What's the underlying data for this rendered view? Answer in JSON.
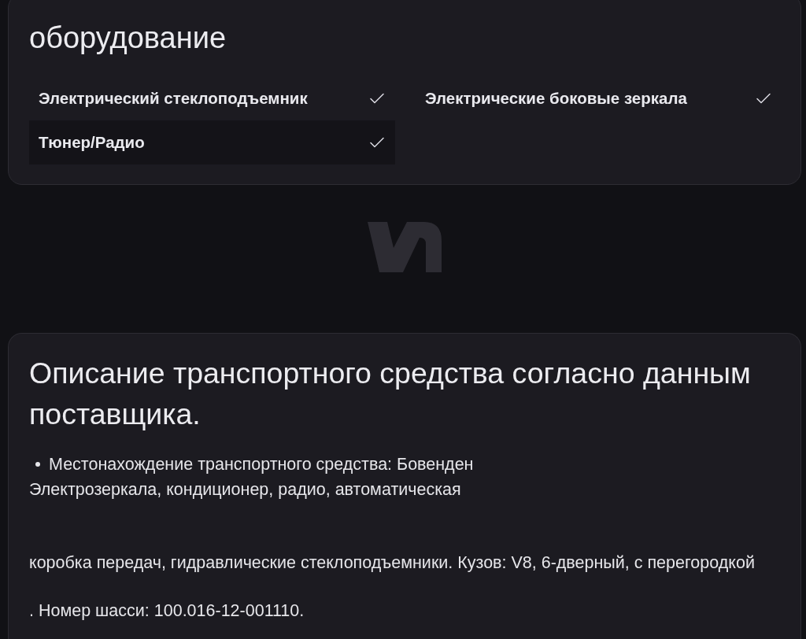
{
  "equipment": {
    "title": "оборудование",
    "columns": [
      {
        "items": [
          {
            "label": "Электрический стеклоподъемник",
            "checked": true
          },
          {
            "label": "Тюнер/Радио",
            "checked": true
          }
        ]
      },
      {
        "items": [
          {
            "label": "Электрические боковые зеркала",
            "checked": true
          }
        ]
      }
    ]
  },
  "description": {
    "title": "Описание транспортного средства согласно данным поставщика.",
    "bullets": [
      "Местонахождение транспортного средства: Бовенден"
    ],
    "paragraphs": [
      "Электрозеркала, кондиционер, радио, автоматическая",
      "коробка передач, гидравлические стеклоподъемники. Кузов: V8, 6-дверный, с перегородкой",
      ". Номер шасси: 100.016-12-001110."
    ]
  }
}
